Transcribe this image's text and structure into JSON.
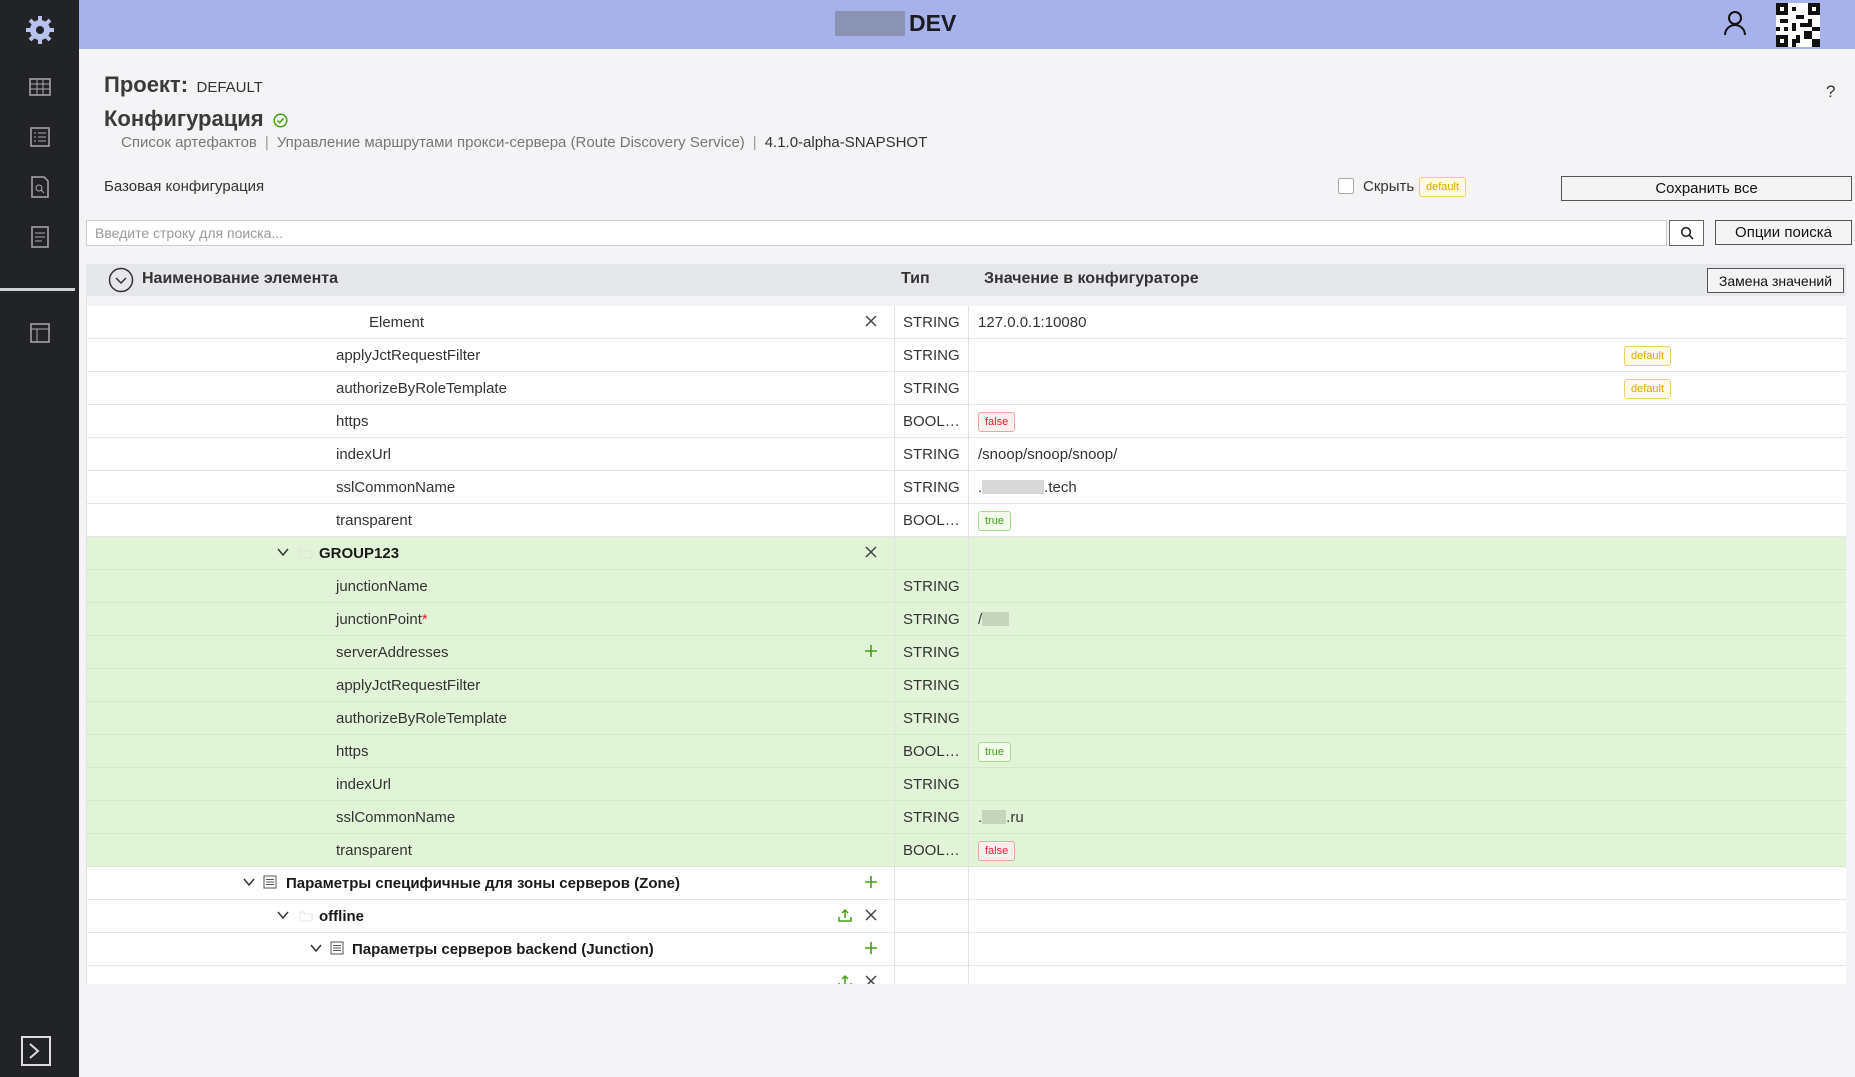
{
  "topbar": {
    "env_title": "DEV"
  },
  "header": {
    "project_label": "Проект:",
    "project_value": "DEFAULT",
    "config_title": "Конфигурация",
    "help": "?",
    "breadcrumbs": [
      "Список артефактов",
      "Управление маршрутами прокси-сервера (Route Discovery Service)",
      "4.1.0-alpha-SNAPSHOT"
    ]
  },
  "toolbar": {
    "base_config_label": "Базовая конфигурация",
    "hide_label": "Скрыть",
    "hide_tag": "default",
    "save_all": "Сохранить все",
    "search_placeholder": "Введите строку для поиска...",
    "search_options": "Опции поиска"
  },
  "table": {
    "col_name": "Наименование элемента",
    "col_type": "Тип",
    "col_value": "Значение в конфигураторе",
    "replace_values": "Замена значений",
    "rows": [
      {
        "name": "Element",
        "type": "STRING",
        "value": "127.0.0.1:10080"
      },
      {
        "name": "applyJctRequestFilter",
        "type": "STRING",
        "value": "",
        "tag": "default"
      },
      {
        "name": "authorizeByRoleTemplate",
        "type": "STRING",
        "value": "",
        "tag": "default"
      },
      {
        "name": "https",
        "type": "BOOLEAN",
        "value_tag": "false"
      },
      {
        "name": "indexUrl",
        "type": "STRING",
        "value": "/snoop/snoop/snoop/"
      },
      {
        "name": "sslCommonName",
        "type": "STRING",
        "value_pre": ".",
        "value_post": ".tech"
      },
      {
        "name": "transparent",
        "type": "BOOLEAN",
        "value_tag": "true"
      },
      {
        "name": "GROUP123",
        "type": "",
        "value": ""
      },
      {
        "name": "junctionName",
        "type": "STRING",
        "value": ""
      },
      {
        "name": "junctionPoint",
        "required": "*",
        "type": "STRING",
        "value_pre": "/"
      },
      {
        "name": "serverAddresses",
        "type": "STRING",
        "value": ""
      },
      {
        "name": "applyJctRequestFilter",
        "type": "STRING",
        "value": ""
      },
      {
        "name": "authorizeByRoleTemplate",
        "type": "STRING",
        "value": ""
      },
      {
        "name": "https",
        "type": "BOOLEAN",
        "value_tag": "true"
      },
      {
        "name": "indexUrl",
        "type": "STRING",
        "value": ""
      },
      {
        "name": "sslCommonName",
        "type": "STRING",
        "value_pre": ".",
        "value_post": ".ru"
      },
      {
        "name": "transparent",
        "type": "BOOLEAN",
        "value_tag": "false"
      },
      {
        "name": "Параметры специфичные для зоны серверов (Zone)",
        "type": "",
        "value": ""
      },
      {
        "name": "offline",
        "type": "",
        "value": ""
      },
      {
        "name": "Параметры серверов backend (Junction)",
        "type": "",
        "value": ""
      }
    ]
  },
  "colors": {
    "sidebar": "#222326",
    "topbar": "#a7b2eb",
    "group_row": "#e2f4d8",
    "accent_green": "#44a014"
  }
}
